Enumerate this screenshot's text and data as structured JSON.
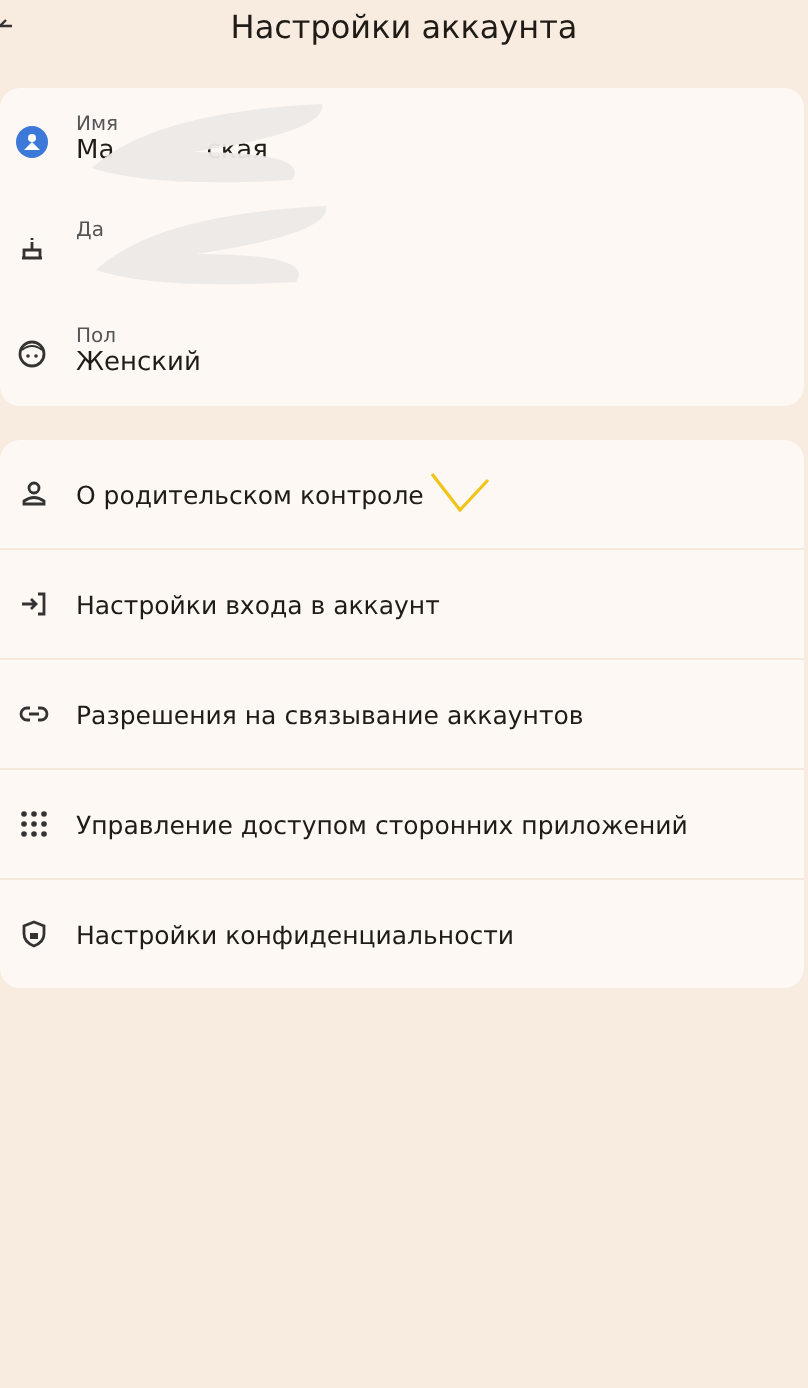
{
  "header": {
    "title": "Настройки аккаунта"
  },
  "profile": [
    {
      "kind": "avatar",
      "label": "Имя",
      "value_parts": [
        "Ма",
        "ская"
      ],
      "redacted": true
    },
    {
      "kind": "cake",
      "label": "Да",
      "redacted": true
    },
    {
      "kind": "face",
      "label": "Пол",
      "value_parts": [
        "Женский"
      ],
      "redacted": false
    }
  ],
  "menu": [
    {
      "kind": "person",
      "label": "О родительском контроле",
      "marked": true
    },
    {
      "kind": "login",
      "label": "Настройки входа в аккаунт",
      "marked": false
    },
    {
      "kind": "link",
      "label": "Разрешения на связывание аккаунтов",
      "marked": false
    },
    {
      "kind": "apps",
      "label": "Управление доступом сторонних приложений",
      "marked": false
    },
    {
      "kind": "shield",
      "label": "Настройки конфиденциальности",
      "marked": false
    }
  ]
}
